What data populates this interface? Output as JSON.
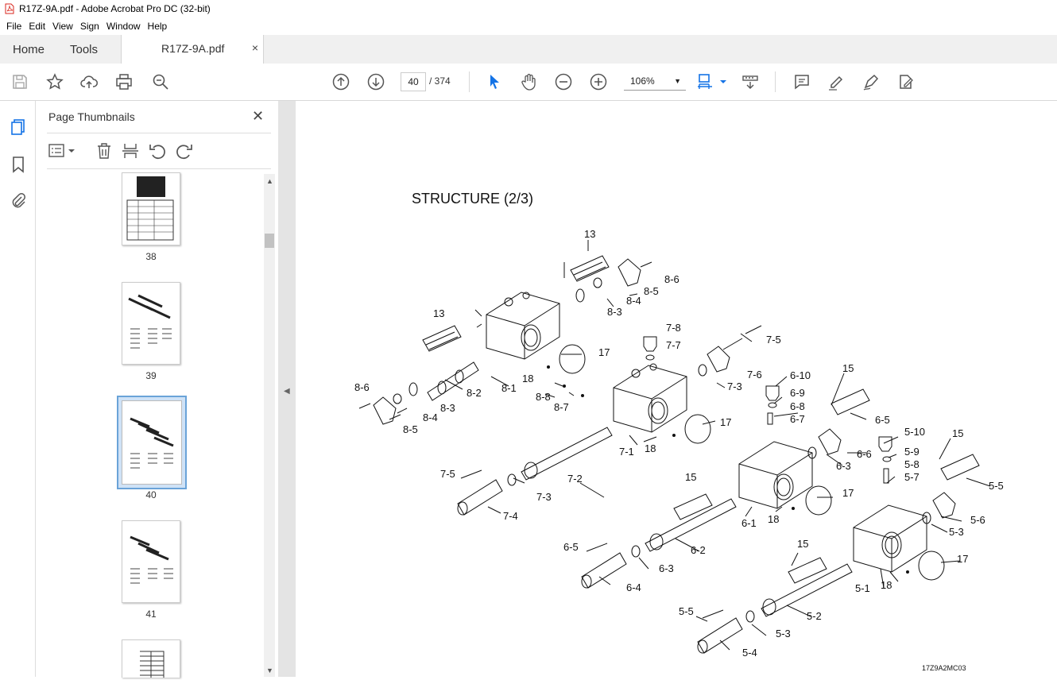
{
  "window": {
    "title": "R17Z-9A.pdf - Adobe Acrobat Pro DC (32-bit)"
  },
  "menu": [
    "File",
    "Edit",
    "View",
    "Sign",
    "Window",
    "Help"
  ],
  "tabs": {
    "home": "Home",
    "tools": "Tools",
    "doc": "R17Z-9A.pdf",
    "close": "×"
  },
  "nav": {
    "page": "40",
    "total": "/ 374",
    "zoom": "106%"
  },
  "panel": {
    "title": "Page Thumbnails",
    "close": "✕",
    "pages": [
      "38",
      "39",
      "40",
      "41"
    ]
  },
  "document": {
    "title": "STRUCTURE (2/3)",
    "ref": "17Z9A2MC03",
    "labels": [
      "13",
      "8-6",
      "8-5",
      "8-4",
      "8-3",
      "17",
      "13",
      "8-1",
      "18",
      "8-8",
      "8-7",
      "8-2",
      "8-6",
      "8-3",
      "8-4",
      "8-5",
      "7-8",
      "7-7",
      "7-5",
      "7-6",
      "7-3",
      "17",
      "7-1",
      "18",
      "7-2",
      "7-5",
      "7-3",
      "7-4",
      "6-10",
      "6-9",
      "6-8",
      "6-7",
      "15",
      "6-5",
      "6-6",
      "6-3",
      "17",
      "18",
      "6-1",
      "15",
      "6-2",
      "6-5",
      "6-3",
      "6-4",
      "5-10",
      "5-9",
      "5-8",
      "5-7",
      "15",
      "5-5",
      "5-6",
      "5-3",
      "17",
      "18",
      "5-1",
      "15",
      "5-2",
      "5-5",
      "5-3",
      "5-4"
    ]
  },
  "colors": {
    "accent": "#1473e6",
    "selection": "#cfe2f6"
  }
}
